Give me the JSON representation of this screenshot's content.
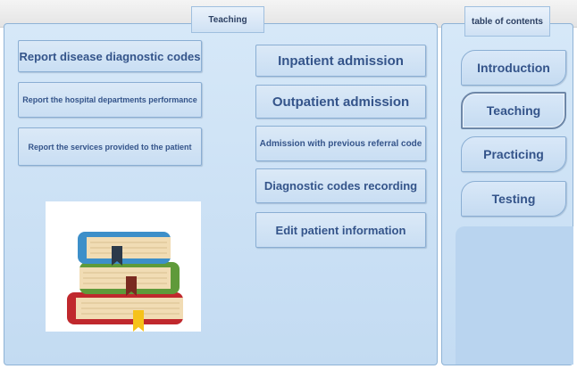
{
  "tabs": {
    "teaching": "Teaching",
    "toc": "table of contents"
  },
  "reports": [
    "Report disease diagnostic codes",
    "Report the hospital departments performance",
    "Report the services provided to the patient"
  ],
  "actions": [
    "Inpatient admission",
    "Outpatient admission",
    "Admission with previous referral code",
    "Diagnostic codes recording",
    "Edit patient information"
  ],
  "toc": [
    "Introduction",
    "Teaching",
    "Practicing",
    "Testing"
  ],
  "toc_selected": "Teaching",
  "illustration": "books-icon",
  "colors": {
    "button_text": "#34548a",
    "panel": "#d6e8f8",
    "book_blue": "#3d8fc9",
    "book_green": "#5f9a3a",
    "book_red": "#c0282d",
    "page": "#f1dcb4"
  }
}
